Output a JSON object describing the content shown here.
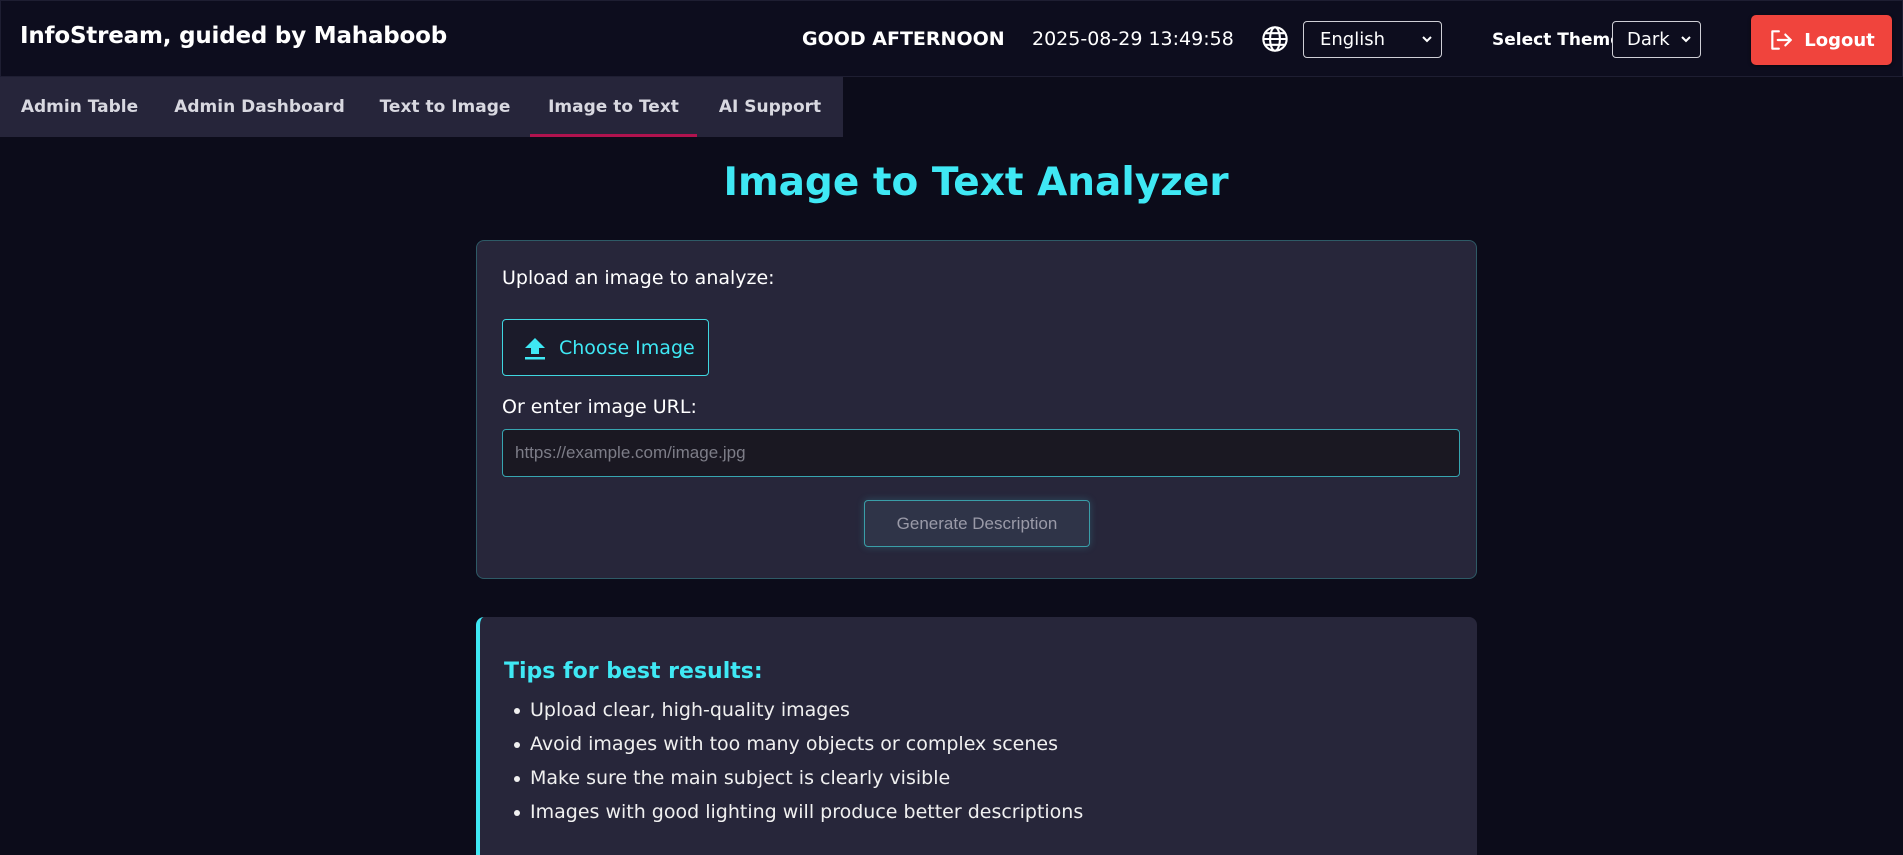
{
  "header": {
    "brand": "InfoStream, guided by Mahaboob",
    "greeting": "GOOD AFTERNOON",
    "datetime": "2025-08-29 13:49:58",
    "language": {
      "selected": "English",
      "icon": "globe-icon"
    },
    "theme": {
      "label": "Select Theme",
      "selected": "Dark"
    },
    "logout": {
      "label": "Logout",
      "icon": "logout-icon",
      "color": "#f0443d"
    }
  },
  "tabs": [
    {
      "label": "Admin Table",
      "active": false
    },
    {
      "label": "Admin Dashboard",
      "active": false
    },
    {
      "label": "Text to Image",
      "active": false
    },
    {
      "label": "Image to Text",
      "active": true
    },
    {
      "label": "AI Support",
      "active": false
    }
  ],
  "main": {
    "title": "Image to Text Analyzer",
    "upload_label": "Upload an image to analyze:",
    "choose_button": {
      "label": "Choose Image",
      "icon": "upload-icon"
    },
    "url_label": "Or enter image URL:",
    "url_input": {
      "value": "",
      "placeholder": "https://example.com/image.jpg"
    },
    "generate_button": "Generate Description"
  },
  "tips": {
    "title": "Tips for best results:",
    "items": [
      "Upload clear, high-quality images",
      "Avoid images with too many objects or complex scenes",
      "Make sure the main subject is clearly visible",
      "Images with good lighting will produce better descriptions"
    ]
  },
  "colors": {
    "accent": "#3fe8f4",
    "active_tab_underline": "#b0134e",
    "background": "#0c0c1a",
    "card": "#27263a"
  }
}
